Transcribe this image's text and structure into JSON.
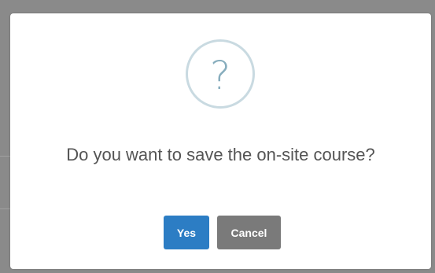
{
  "dialog": {
    "icon": "question-mark-icon",
    "icon_glyph": "?",
    "message": "Do you want to save the on-site course?",
    "buttons": {
      "confirm_label": "Yes",
      "cancel_label": "Cancel"
    }
  },
  "colors": {
    "confirm_button": "#2c7dc4",
    "cancel_button": "#7a7a7a",
    "icon_ring": "#c9dae1",
    "icon_glyph": "#87adbd",
    "backdrop": "#8a8a8a"
  }
}
